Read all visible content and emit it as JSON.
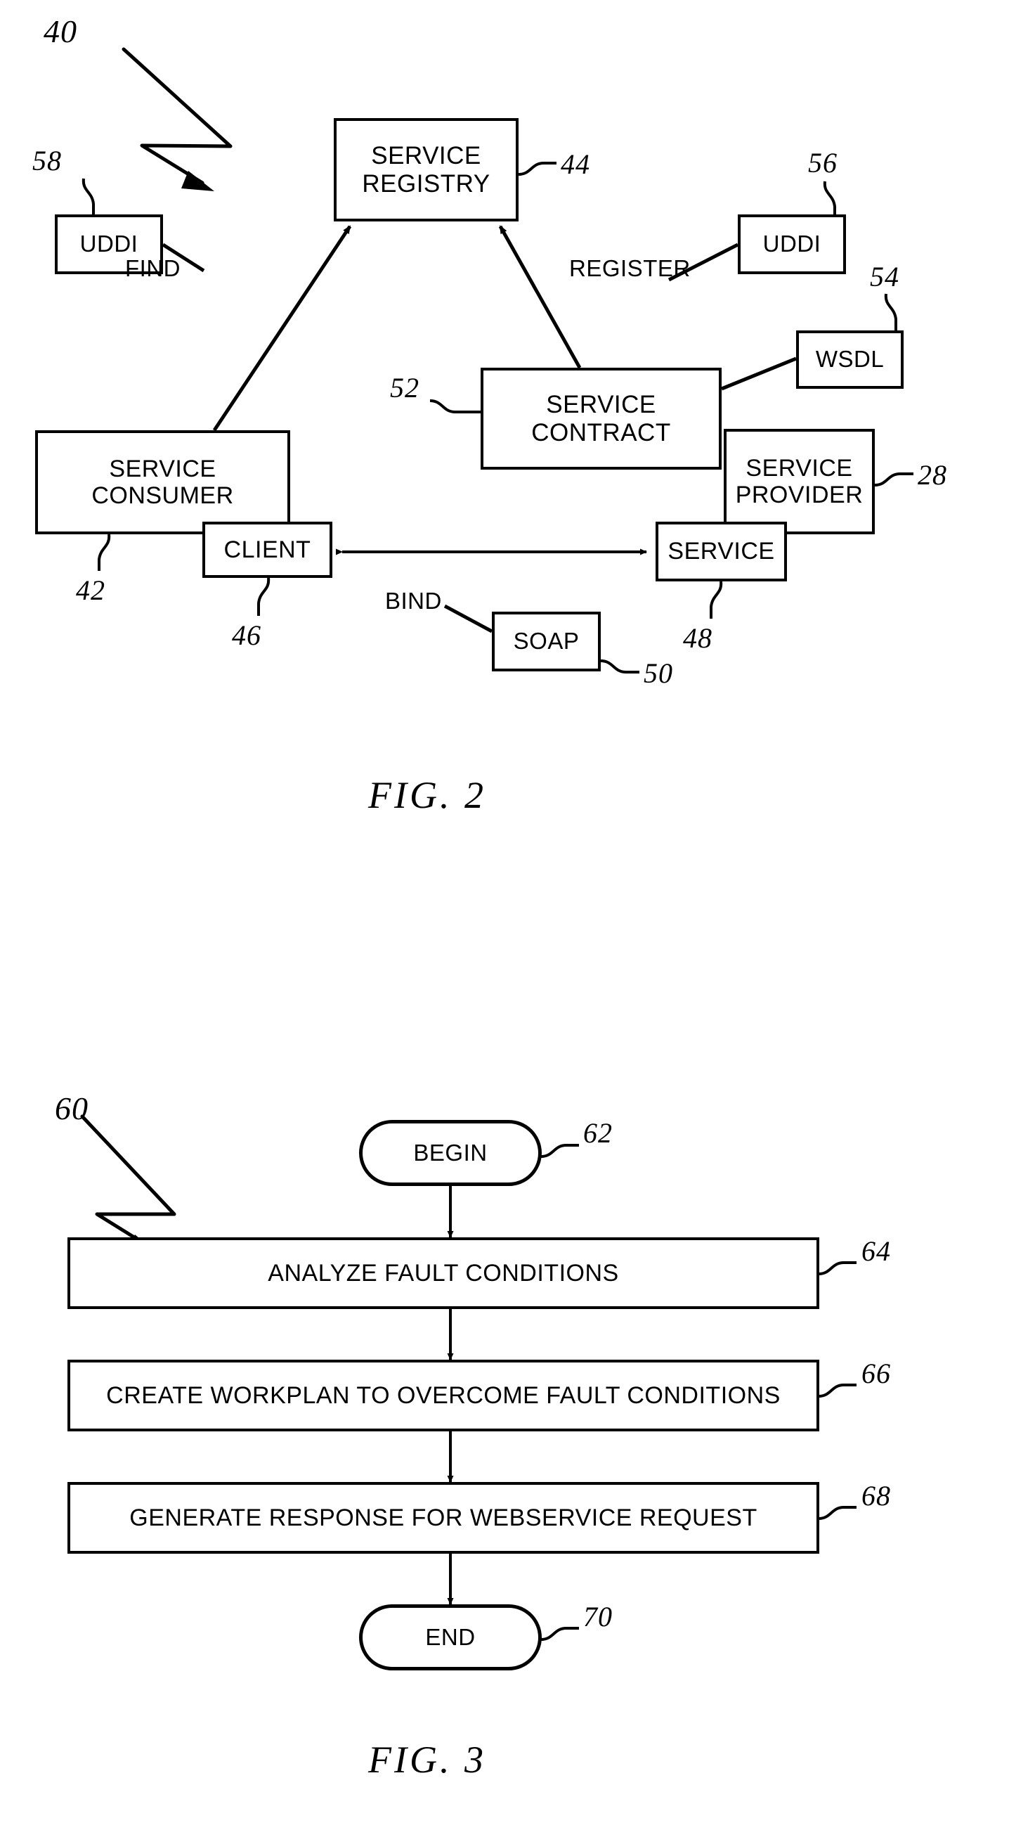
{
  "figures": [
    {
      "id": "fig2",
      "caption": "FIG. 2",
      "ref": "40",
      "nodes": [
        {
          "key": "service_registry",
          "label": "SERVICE\nREGISTRY",
          "ref": "44"
        },
        {
          "key": "uddi_left",
          "label": "UDDI",
          "ref": "58"
        },
        {
          "key": "uddi_right",
          "label": "UDDI",
          "ref": "56"
        },
        {
          "key": "wsdl",
          "label": "WSDL",
          "ref": "54"
        },
        {
          "key": "service_contract",
          "label": "SERVICE\nCONTRACT",
          "ref": "52"
        },
        {
          "key": "service_consumer",
          "label": "SERVICE CONSUMER",
          "ref": "42"
        },
        {
          "key": "client",
          "label": "CLIENT",
          "ref": "46"
        },
        {
          "key": "service_provider",
          "label": "SERVICE\nPROVIDER",
          "ref": "28"
        },
        {
          "key": "service",
          "label": "SERVICE",
          "ref": "48"
        },
        {
          "key": "soap",
          "label": "SOAP",
          "ref": "50"
        }
      ],
      "edge_labels": [
        {
          "key": "find",
          "label": "FIND"
        },
        {
          "key": "register",
          "label": "REGISTER"
        },
        {
          "key": "bind",
          "label": "BIND"
        }
      ]
    },
    {
      "id": "fig3",
      "caption": "FIG. 3",
      "ref": "60",
      "steps": [
        {
          "key": "begin",
          "label": "BEGIN",
          "ref": "62",
          "shape": "terminator"
        },
        {
          "key": "analyze",
          "label": "ANALYZE FAULT CONDITIONS",
          "ref": "64",
          "shape": "process"
        },
        {
          "key": "workplan",
          "label": "CREATE WORKPLAN TO OVERCOME FAULT CONDITIONS",
          "ref": "66",
          "shape": "process"
        },
        {
          "key": "response",
          "label": "GENERATE RESPONSE FOR WEBSERVICE REQUEST",
          "ref": "68",
          "shape": "process"
        },
        {
          "key": "end",
          "label": "END",
          "ref": "70",
          "shape": "terminator"
        }
      ]
    }
  ],
  "colors": {
    "ink": "#000000",
    "paper": "#ffffff"
  }
}
